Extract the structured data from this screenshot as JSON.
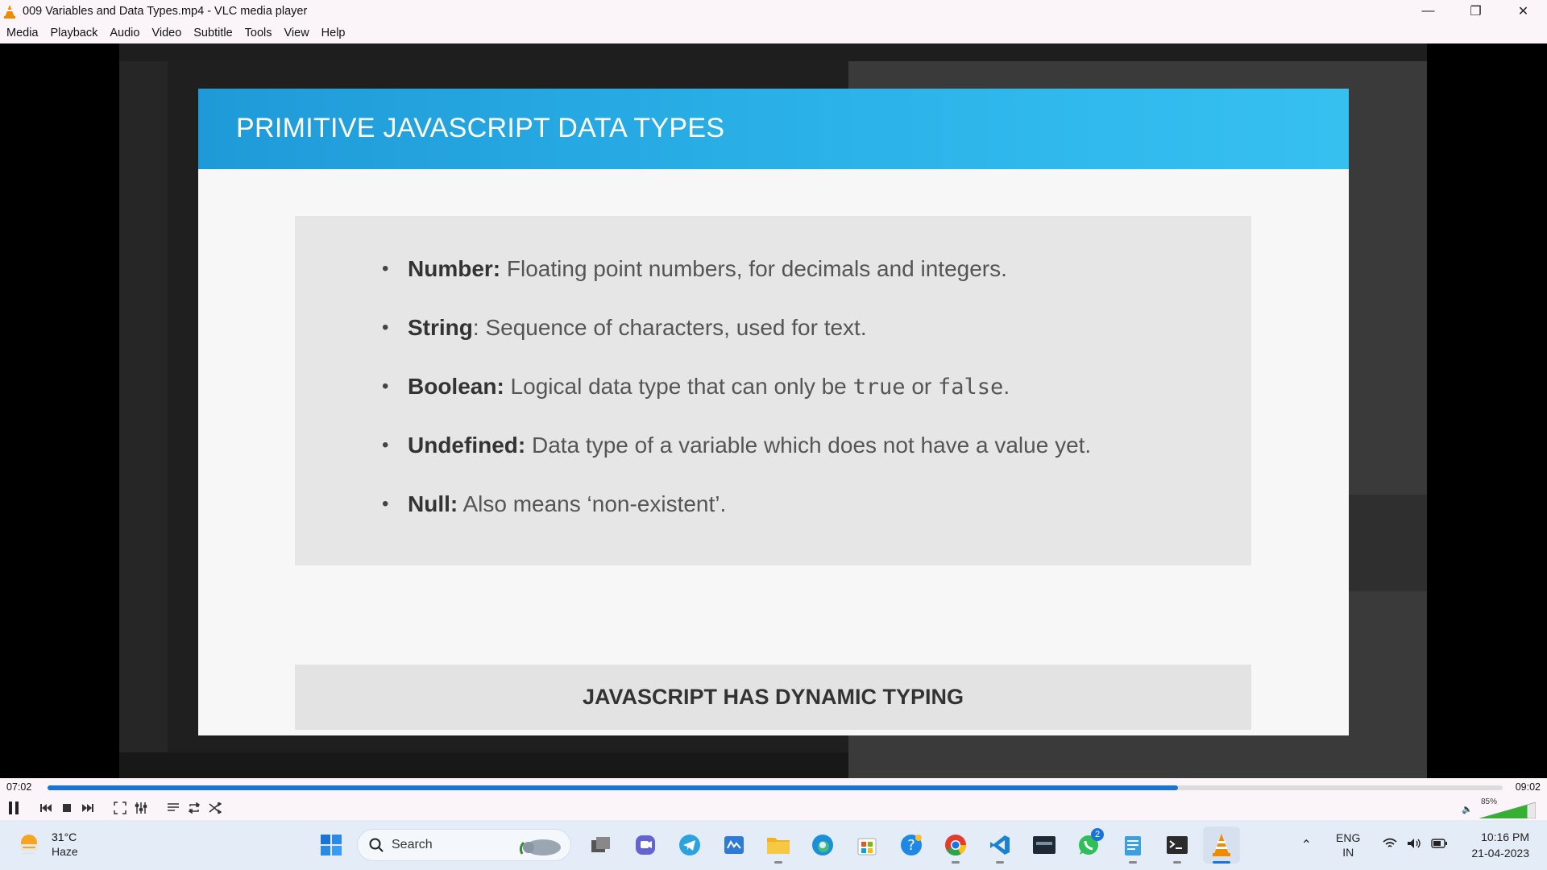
{
  "window": {
    "title": "009 Variables and Data Types.mp4 - VLC media player",
    "controls": {
      "minimize": "—",
      "restore": "❐",
      "close": "✕"
    }
  },
  "menu": [
    "Media",
    "Playback",
    "Audio",
    "Video",
    "Subtitle",
    "Tools",
    "View",
    "Help"
  ],
  "slide": {
    "title": "PRIMITIVE JAVASCRIPT DATA TYPES",
    "bullets": [
      {
        "term": "Number:",
        "text": " Floating point numbers, for decimals and integers."
      },
      {
        "term": "String",
        "text": ": Sequence of characters, used for text."
      },
      {
        "term": "Boolean:",
        "text": " Logical data type that can only be ",
        "code1": "true",
        "mid": " or ",
        "code2": "false",
        "end": "."
      },
      {
        "term": "Undefined:",
        "text": " Data type of a variable which does not have a value yet."
      },
      {
        "term": "Null:",
        "text": " Also means ‘non-existent’."
      }
    ],
    "footer": "JAVASCRIPT HAS DYNAMIC TYPING"
  },
  "player": {
    "elapsed": "07:02",
    "duration": "09:02",
    "progress": 0.777,
    "volume_label": "85%",
    "volume": 0.85,
    "accent": "#1a73d6"
  },
  "taskbar": {
    "weather": {
      "temp": "31°C",
      "condition": "Haze"
    },
    "search_label": "Search",
    "whatsapp_badge": "2",
    "lang": {
      "line1": "ENG",
      "line2": "IN"
    },
    "clock": {
      "time": "10:16 PM",
      "date": "21-04-2023"
    }
  }
}
